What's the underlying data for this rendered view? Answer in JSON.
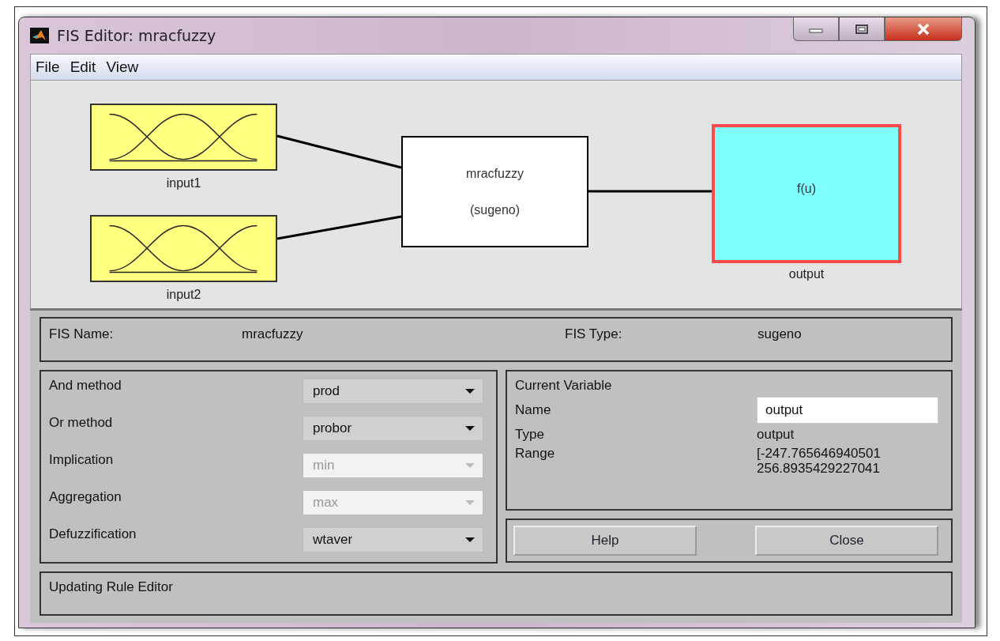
{
  "window": {
    "title": "FIS Editor: mracfuzzy"
  },
  "menu": [
    "File",
    "Edit",
    "View"
  ],
  "diagram": {
    "inputs": [
      {
        "label": "input1"
      },
      {
        "label": "input2"
      }
    ],
    "system": {
      "name": "mracfuzzy",
      "type": "(sugeno)"
    },
    "output": {
      "function": "f(u)",
      "label": "output",
      "selected": true
    }
  },
  "fis": {
    "name_label": "FIS Name:",
    "name": "mracfuzzy",
    "type_label": "FIS Type:",
    "type": "sugeno"
  },
  "methods": [
    {
      "label": "And method",
      "value": "prod",
      "disabled": false
    },
    {
      "label": "Or method",
      "value": "probor",
      "disabled": false
    },
    {
      "label": "Implication",
      "value": "min",
      "disabled": true
    },
    {
      "label": "Aggregation",
      "value": "max",
      "disabled": true
    },
    {
      "label": "Defuzzification",
      "value": "wtaver",
      "disabled": false
    }
  ],
  "current_variable": {
    "title": "Current Variable",
    "name_label": "Name",
    "name": "output",
    "type_label": "Type",
    "type": "output",
    "range_label": "Range",
    "range": [
      "[-247.765646940501",
      "256.8935429227041"
    ]
  },
  "buttons": [
    "Help",
    "Close"
  ],
  "status": "Updating Rule Editor"
}
